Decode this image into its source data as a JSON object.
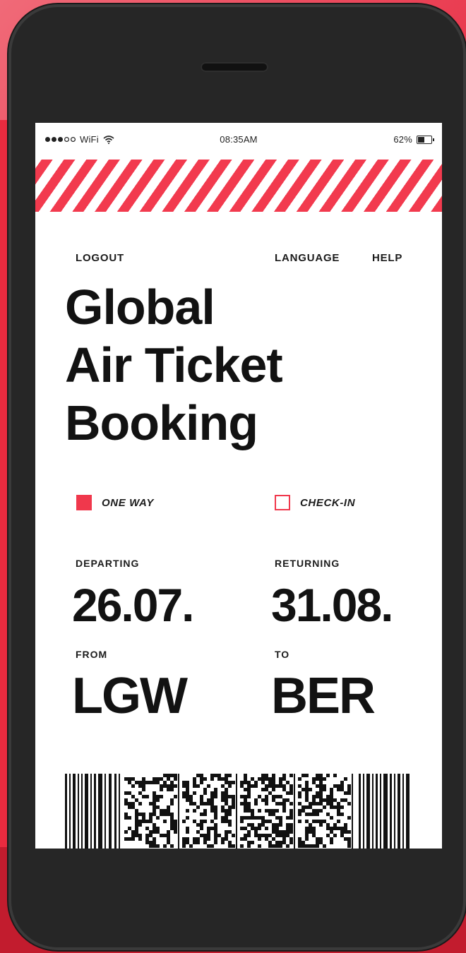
{
  "status_bar": {
    "carrier": "WiFi",
    "time": "08:35AM",
    "battery": "62%",
    "battery_level": 0.62
  },
  "nav": {
    "logout": "LOGOUT",
    "language": "LANGUAGE",
    "help": "HELP"
  },
  "title_lines": [
    "Global",
    "Air Ticket",
    "Booking"
  ],
  "options": {
    "one_way": {
      "label": "ONE WAY",
      "checked": true
    },
    "check_in": {
      "label": "CHECK-IN",
      "checked": false
    }
  },
  "trip": {
    "departing_label": "DEPARTING",
    "departing_date": "26.07.",
    "returning_label": "RETURNING",
    "returning_date": "31.08.",
    "from_label": "FROM",
    "from_code": "LGW",
    "to_label": "TO",
    "to_code": "BER"
  },
  "colors": {
    "accent": "#f0384c",
    "text": "#121212",
    "phone": "#262626"
  },
  "icons": [
    "signal-dots-icon",
    "wifi-icon",
    "battery-icon",
    "barcode-icon"
  ]
}
